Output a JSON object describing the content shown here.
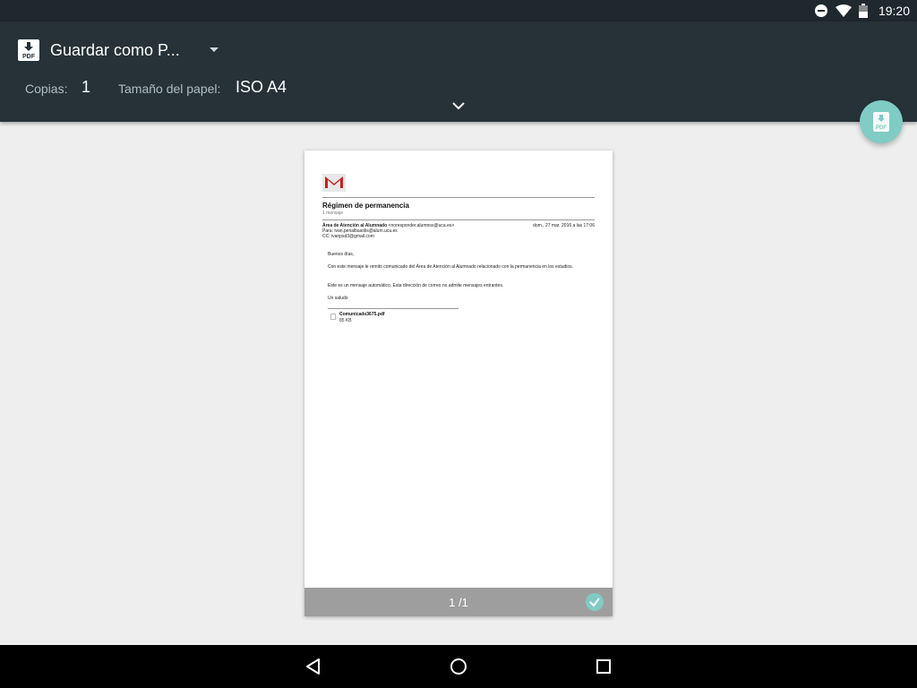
{
  "status_bar": {
    "time": "19:20",
    "icons": [
      "do-not-disturb-icon",
      "wifi-icon",
      "battery-icon"
    ]
  },
  "print_options": {
    "destination_label": "Guardar como P...",
    "destination_icon": "pdf-download-icon",
    "copies_label": "Copias:",
    "copies_value": "1",
    "paper_size_label": "Tamaño del papel:",
    "paper_size_value": "ISO A4",
    "expand_icon": "chevron-down-icon"
  },
  "fab": {
    "icon": "pdf-save-icon",
    "color": "#80cbc4"
  },
  "preview": {
    "page_number": "1 /1",
    "page_selected": true,
    "email": {
      "subject": "Régimen de permanencia",
      "message_count": "1 mensaje",
      "sender_name": "Área de Atención al Alumnado",
      "sender_email": "<noresponder.alumnos@uca.es>",
      "date": "dom., 27 mar. 2016 a las 17:06",
      "to": "Para: ivan.penalbasolis@alum.uca.es",
      "cc": "CC: ivanpsd3@gmail.com",
      "greeting": "Buenos días,",
      "paragraph1": "Con este mensaje le remito comunicado del Área de Atención al Alumnado relacionado con la permanencia en los estudios.",
      "paragraph2": "Este es un mensaje automático. Esta dirección de correo no admite mensajes entrantes.",
      "closing": "Un saludo",
      "attachment_name": "Comunicado3675.pdf",
      "attachment_size": "85 KB"
    }
  },
  "colors": {
    "status_bar": "#1f282d",
    "header": "#263238",
    "accent": "#80cbc4",
    "page_footer": "#9e9e9e",
    "background": "#eeeeee"
  }
}
